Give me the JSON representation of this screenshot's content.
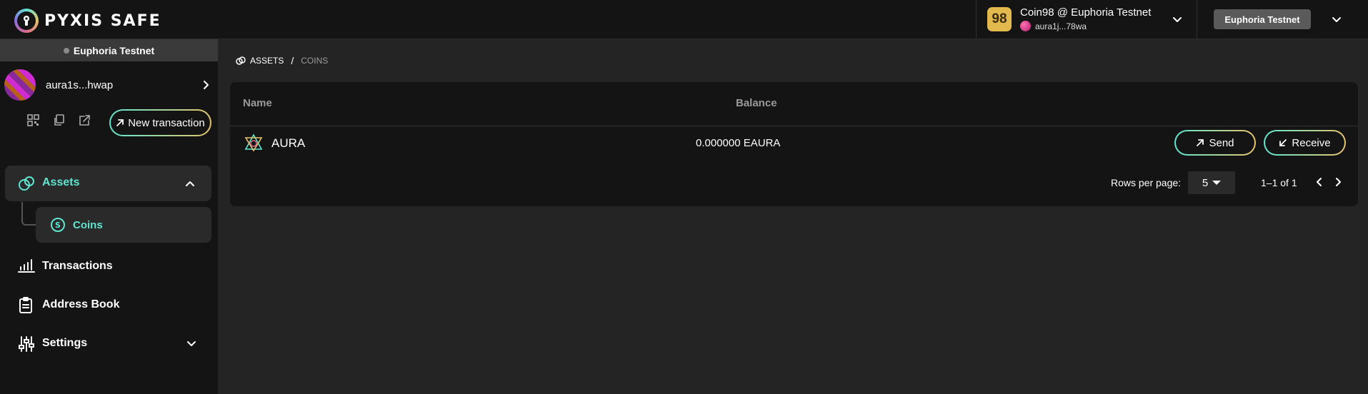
{
  "header": {
    "brand": "PYXIS SAFE",
    "wallet": {
      "logo_text": "98",
      "name": "Coin98 @ Euphoria Testnet",
      "address": "aura1j...78wa"
    },
    "network_button": "Euphoria Testnet"
  },
  "sidebar": {
    "network_banner": "Euphoria Testnet",
    "safe_address": "aura1s...hwap",
    "new_transaction": "New transaction",
    "nav": {
      "assets": "Assets",
      "coins": "Coins",
      "transactions": "Transactions",
      "address_book": "Address Book",
      "settings": "Settings"
    }
  },
  "breadcrumb": {
    "assets": "ASSETS",
    "separator": "/",
    "coins": "COINS"
  },
  "table": {
    "columns": [
      "Name",
      "Balance"
    ],
    "rows": [
      {
        "name": "AURA",
        "balance": "0.000000 EAURA",
        "send": "Send",
        "receive": "Receive"
      }
    ]
  },
  "pagination": {
    "rows_per_page_label": "Rows per page:",
    "rows_per_page": "5",
    "range": "1–1 of 1"
  },
  "colors": {
    "accent_teal": "#5ee6d0",
    "accent_gold": "#e6c36a",
    "background": "#242424",
    "panel": "#141414"
  }
}
